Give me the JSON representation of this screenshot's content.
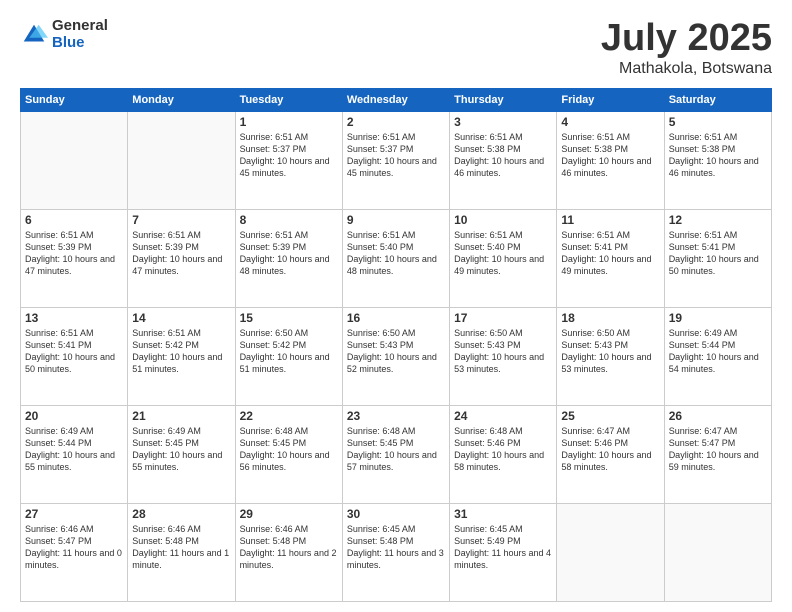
{
  "logo": {
    "general": "General",
    "blue": "Blue"
  },
  "title": {
    "month": "July 2025",
    "location": "Mathakola, Botswana"
  },
  "headers": [
    "Sunday",
    "Monday",
    "Tuesday",
    "Wednesday",
    "Thursday",
    "Friday",
    "Saturday"
  ],
  "weeks": [
    [
      {
        "day": "",
        "empty": true
      },
      {
        "day": "",
        "empty": true
      },
      {
        "day": "1",
        "sunrise": "6:51 AM",
        "sunset": "5:37 PM",
        "daylight": "10 hours and 45 minutes."
      },
      {
        "day": "2",
        "sunrise": "6:51 AM",
        "sunset": "5:37 PM",
        "daylight": "10 hours and 45 minutes."
      },
      {
        "day": "3",
        "sunrise": "6:51 AM",
        "sunset": "5:38 PM",
        "daylight": "10 hours and 46 minutes."
      },
      {
        "day": "4",
        "sunrise": "6:51 AM",
        "sunset": "5:38 PM",
        "daylight": "10 hours and 46 minutes."
      },
      {
        "day": "5",
        "sunrise": "6:51 AM",
        "sunset": "5:38 PM",
        "daylight": "10 hours and 46 minutes."
      }
    ],
    [
      {
        "day": "6",
        "sunrise": "6:51 AM",
        "sunset": "5:39 PM",
        "daylight": "10 hours and 47 minutes."
      },
      {
        "day": "7",
        "sunrise": "6:51 AM",
        "sunset": "5:39 PM",
        "daylight": "10 hours and 47 minutes."
      },
      {
        "day": "8",
        "sunrise": "6:51 AM",
        "sunset": "5:39 PM",
        "daylight": "10 hours and 48 minutes."
      },
      {
        "day": "9",
        "sunrise": "6:51 AM",
        "sunset": "5:40 PM",
        "daylight": "10 hours and 48 minutes."
      },
      {
        "day": "10",
        "sunrise": "6:51 AM",
        "sunset": "5:40 PM",
        "daylight": "10 hours and 49 minutes."
      },
      {
        "day": "11",
        "sunrise": "6:51 AM",
        "sunset": "5:41 PM",
        "daylight": "10 hours and 49 minutes."
      },
      {
        "day": "12",
        "sunrise": "6:51 AM",
        "sunset": "5:41 PM",
        "daylight": "10 hours and 50 minutes."
      }
    ],
    [
      {
        "day": "13",
        "sunrise": "6:51 AM",
        "sunset": "5:41 PM",
        "daylight": "10 hours and 50 minutes."
      },
      {
        "day": "14",
        "sunrise": "6:51 AM",
        "sunset": "5:42 PM",
        "daylight": "10 hours and 51 minutes."
      },
      {
        "day": "15",
        "sunrise": "6:50 AM",
        "sunset": "5:42 PM",
        "daylight": "10 hours and 51 minutes."
      },
      {
        "day": "16",
        "sunrise": "6:50 AM",
        "sunset": "5:43 PM",
        "daylight": "10 hours and 52 minutes."
      },
      {
        "day": "17",
        "sunrise": "6:50 AM",
        "sunset": "5:43 PM",
        "daylight": "10 hours and 53 minutes."
      },
      {
        "day": "18",
        "sunrise": "6:50 AM",
        "sunset": "5:43 PM",
        "daylight": "10 hours and 53 minutes."
      },
      {
        "day": "19",
        "sunrise": "6:49 AM",
        "sunset": "5:44 PM",
        "daylight": "10 hours and 54 minutes."
      }
    ],
    [
      {
        "day": "20",
        "sunrise": "6:49 AM",
        "sunset": "5:44 PM",
        "daylight": "10 hours and 55 minutes."
      },
      {
        "day": "21",
        "sunrise": "6:49 AM",
        "sunset": "5:45 PM",
        "daylight": "10 hours and 55 minutes."
      },
      {
        "day": "22",
        "sunrise": "6:48 AM",
        "sunset": "5:45 PM",
        "daylight": "10 hours and 56 minutes."
      },
      {
        "day": "23",
        "sunrise": "6:48 AM",
        "sunset": "5:45 PM",
        "daylight": "10 hours and 57 minutes."
      },
      {
        "day": "24",
        "sunrise": "6:48 AM",
        "sunset": "5:46 PM",
        "daylight": "10 hours and 58 minutes."
      },
      {
        "day": "25",
        "sunrise": "6:47 AM",
        "sunset": "5:46 PM",
        "daylight": "10 hours and 58 minutes."
      },
      {
        "day": "26",
        "sunrise": "6:47 AM",
        "sunset": "5:47 PM",
        "daylight": "10 hours and 59 minutes."
      }
    ],
    [
      {
        "day": "27",
        "sunrise": "6:46 AM",
        "sunset": "5:47 PM",
        "daylight": "11 hours and 0 minutes."
      },
      {
        "day": "28",
        "sunrise": "6:46 AM",
        "sunset": "5:48 PM",
        "daylight": "11 hours and 1 minute."
      },
      {
        "day": "29",
        "sunrise": "6:46 AM",
        "sunset": "5:48 PM",
        "daylight": "11 hours and 2 minutes."
      },
      {
        "day": "30",
        "sunrise": "6:45 AM",
        "sunset": "5:48 PM",
        "daylight": "11 hours and 3 minutes."
      },
      {
        "day": "31",
        "sunrise": "6:45 AM",
        "sunset": "5:49 PM",
        "daylight": "11 hours and 4 minutes."
      },
      {
        "day": "",
        "empty": true
      },
      {
        "day": "",
        "empty": true
      }
    ]
  ]
}
